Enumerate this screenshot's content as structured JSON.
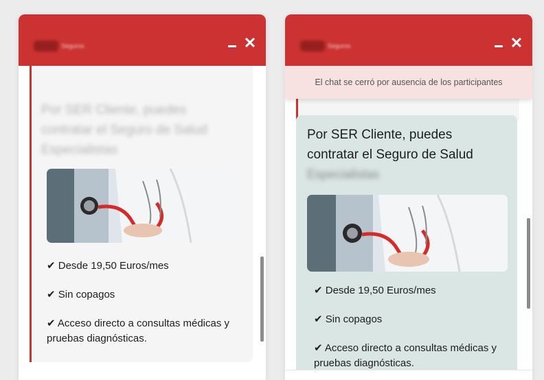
{
  "widgets": [
    {
      "card": {
        "title": "Por SER Cliente, puedes contratar el Seguro de Salud Especialistas",
        "features": [
          "✔ Desde 19,50 Euros/mes",
          "✔ Sin copagos",
          "✔ Acceso directo a consultas médicas y pruebas diagnósticas."
        ]
      }
    },
    {
      "notice": "El chat se cerró por ausencia de los participantes",
      "card": {
        "title": "Por SER Cliente, puedes contratar el Seguro de Salud",
        "title_blurred": "Especialistas",
        "features": [
          "✔ Desde 19,50 Euros/mes",
          "✔ Sin copagos",
          "✔ Acceso directo a consultas médicas y pruebas diagnósticas."
        ]
      }
    }
  ],
  "header": {
    "minimize_icon": "minimize-icon",
    "close_icon": "close-icon",
    "close_glyph": "✕"
  },
  "colors": {
    "brand": "#cc3232",
    "card_teal": "#d9e6e4",
    "card_grey": "#f5f5f5",
    "notice_bg": "#f8e1e1"
  }
}
